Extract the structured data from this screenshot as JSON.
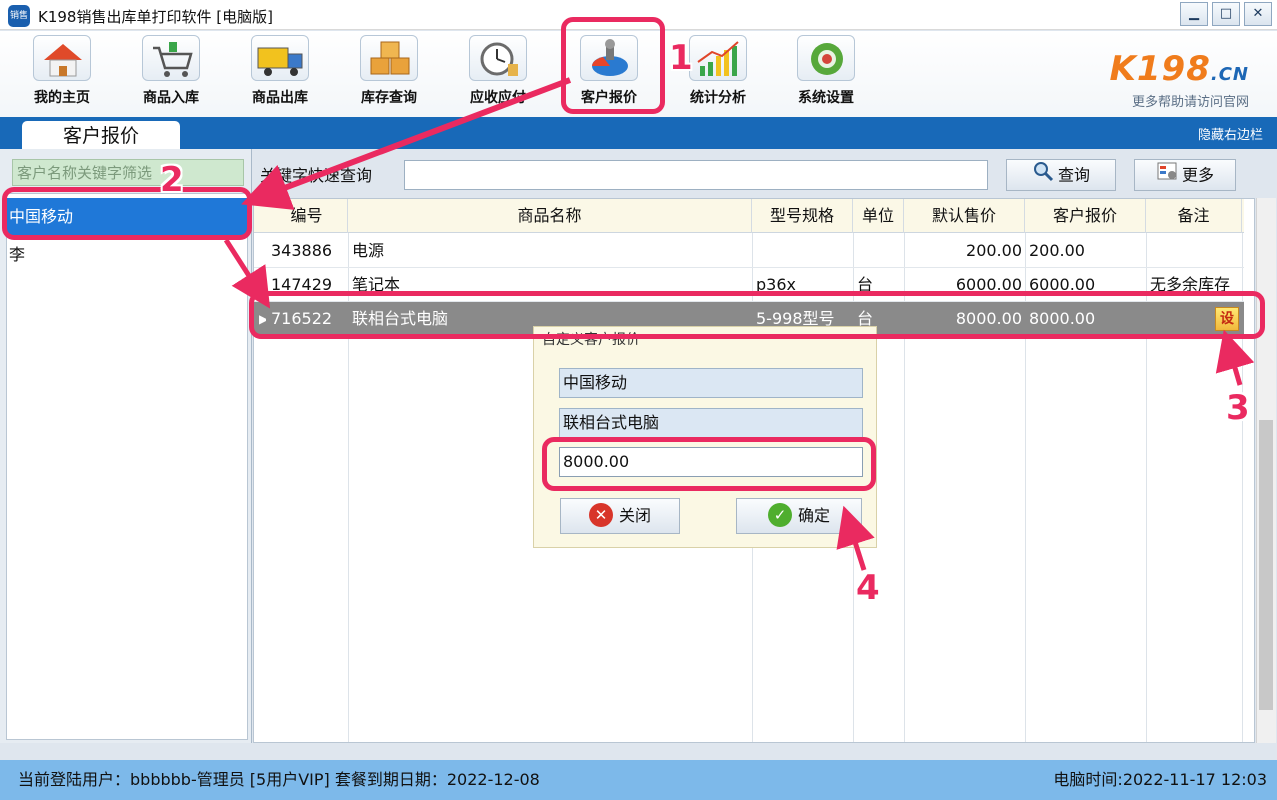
{
  "window": {
    "title": "K198销售出库单打印软件 [电脑版]",
    "logo_text": "销售",
    "minimize": "▁",
    "maximize": "□",
    "close": "✕"
  },
  "toolbar": {
    "items": [
      {
        "label": "我的主页",
        "icon": "home-icon"
      },
      {
        "label": "商品入库",
        "icon": "cart-icon"
      },
      {
        "label": "商品出库",
        "icon": "truck-icon"
      },
      {
        "label": "库存查询",
        "icon": "boxes-icon"
      },
      {
        "label": "应收应付",
        "icon": "clock-icon"
      },
      {
        "label": "客户报价",
        "icon": "pie-chart-icon"
      },
      {
        "label": "统计分析",
        "icon": "bar-chart-icon"
      },
      {
        "label": "系统设置",
        "icon": "gear-icon"
      }
    ]
  },
  "brand": {
    "logo": "K198",
    "logo_suffix": ".CN",
    "subtitle": "更多帮助请访问官网"
  },
  "tabs": {
    "active": "客户报价",
    "hide_sidebar": "隐藏右边栏"
  },
  "left": {
    "filter_placeholder": "客户名称关键字筛选",
    "customers": [
      "中国移动",
      "李"
    ]
  },
  "search": {
    "label": "关键字快速查询",
    "query_button": "查询",
    "more_button": "更多"
  },
  "grid": {
    "columns": [
      "编号",
      "商品名称",
      "型号规格",
      "单位",
      "默认售价",
      "客户报价",
      "备注"
    ],
    "rows": [
      {
        "id": "343886",
        "name": "电源",
        "spec": "",
        "unit": "",
        "default_price": "200.00",
        "customer_price": "200.00",
        "note": ""
      },
      {
        "id": "147429",
        "name": "笔记本",
        "spec": "p36x",
        "unit": "台",
        "default_price": "6000.00",
        "customer_price": "6000.00",
        "note": "无多余库存"
      },
      {
        "id": "716522",
        "name": "联相台式电脑",
        "spec": "5-998型号",
        "unit": "台",
        "default_price": "8000.00",
        "customer_price": "8000.00",
        "note": ""
      }
    ],
    "set_button": "设"
  },
  "dialog": {
    "title": "自定义客户报价",
    "customer": "中国移动",
    "product": "联相台式电脑",
    "price": "8000.00",
    "close_button": "关闭",
    "confirm_button": "确定"
  },
  "status": {
    "user": "当前登陆用户：bbbbbb-管理员  [5用户VIP] 套餐到期日期：2022-12-08",
    "time": "电脑时间:2022-11-17 12:03"
  },
  "annotations": [
    "1",
    "2",
    "3",
    "4"
  ],
  "colors": {
    "highlight": "#ea2a60",
    "tabstrip": "#1869b8",
    "selected": "#1f78d8",
    "statusbar": "#7db9ea"
  }
}
